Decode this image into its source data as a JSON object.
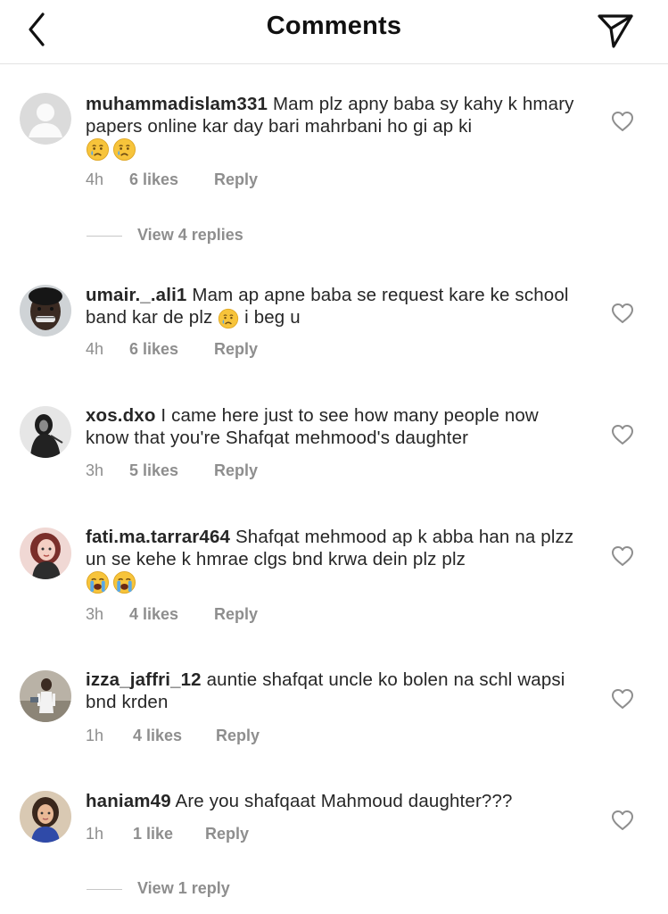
{
  "header": {
    "title": "Comments",
    "back_icon": "chevron-left-icon",
    "share_icon": "paper-plane-icon"
  },
  "comments": [
    {
      "username": "muhammadislam331",
      "text": "Mam plz apny baba sy kahy k hmary papers online kar day bari mahrbani ho gi ap ki",
      "emoji": [
        "crying-face-icon",
        "crying-face-icon"
      ],
      "time": "4h",
      "likes": "6 likes",
      "reply_label": "Reply",
      "view_replies": "View 4 replies"
    },
    {
      "username": "umair._.ali1",
      "text": "Mam ap apne baba se request kare ke school band kar de plz",
      "emoji_inline": "crying-face-icon",
      "text_after": "i beg u",
      "time": "4h",
      "likes": "6 likes",
      "reply_label": "Reply"
    },
    {
      "username": "xos.dxo",
      "text": "I came here just to see how many people now know that you're Shafqat mehmood's daughter",
      "time": "3h",
      "likes": "5 likes",
      "reply_label": "Reply"
    },
    {
      "username": "fati.ma.tarrar464",
      "text": "Shafqat mehmood ap k abba han na plzz un se kehe k hmrae clgs bnd krwa dein plz plz",
      "emoji": [
        "loudly-crying-face-icon",
        "loudly-crying-face-icon"
      ],
      "time": "3h",
      "likes": "4 likes",
      "reply_label": "Reply"
    },
    {
      "username": "izza_jaffri_12",
      "text": "auntie shafqat uncle ko bolen na schl wapsi bnd krden",
      "time": "1h",
      "likes": "4 likes",
      "reply_label": "Reply"
    },
    {
      "username": "haniam49",
      "text": "Are you shafqaat Mahmoud daughter???",
      "time": "1h",
      "likes": "1 like",
      "reply_label": "Reply",
      "view_replies": "View 1 reply"
    }
  ],
  "colors": {
    "text": "#262626",
    "meta": "#8e8e8e",
    "divider": "#e3e3e3",
    "emoji_face": "#f7c43b",
    "emoji_tear": "#5aa9e6"
  }
}
